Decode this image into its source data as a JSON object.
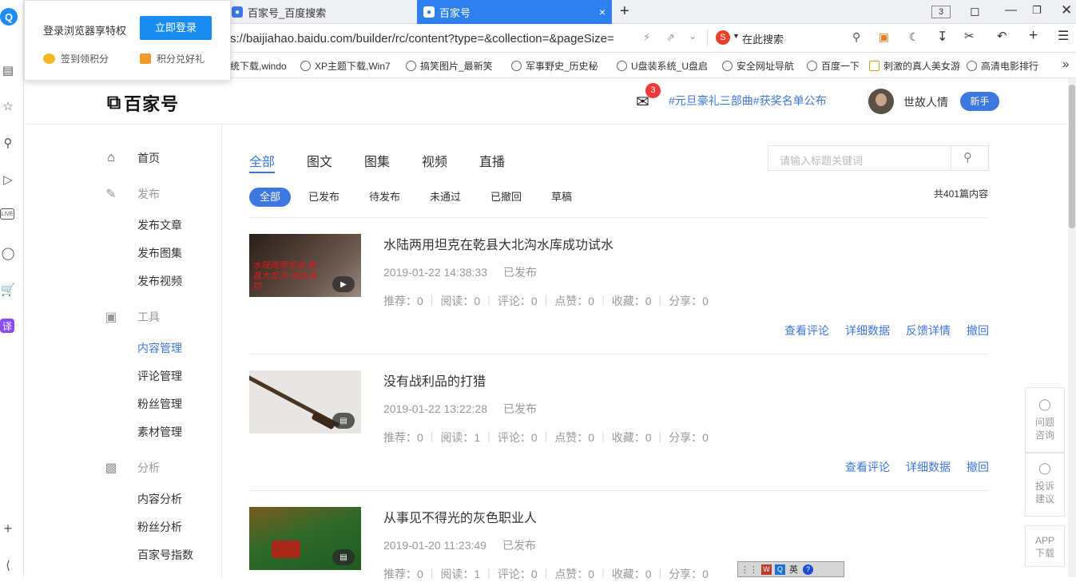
{
  "browser": {
    "tabs": [
      {
        "label": "百家号_百度搜索"
      },
      {
        "label": "百家号",
        "close": "×"
      }
    ],
    "new_tab": "+",
    "tab_count": "3",
    "url": "s://baijiahao.baidu.com/builder/rc/content?type=&collection=&pageSize=",
    "search_placeholder": "在此搜索",
    "bookmarks": [
      "统下载,windo",
      "XP主题下载,Win7",
      "搞笑图片_最新笑",
      "军事野史_历史秘",
      "U盘装系统_U盘启",
      "安全网址导航",
      "百度一下",
      "刺激的真人美女游",
      "高清电影排行"
    ],
    "more": "»"
  },
  "popup": {
    "title": "登录浏览器享特权",
    "login_button": "立即登录",
    "link1": "签到领积分",
    "link2": "积分兑好礼"
  },
  "header": {
    "logo_text": "百家号",
    "mail_badge": "3",
    "promo": "#元旦豪礼三部曲#获奖名单公布",
    "username": "世故人情",
    "level_badge": "新手"
  },
  "sidebar": {
    "home": "首页",
    "publish": "发布",
    "publish_items": [
      "发布文章",
      "发布图集",
      "发布视频"
    ],
    "tools": "工具",
    "tool_items": [
      "内容管理",
      "评论管理",
      "粉丝管理",
      "素材管理"
    ],
    "analysis": "分析",
    "analysis_items": [
      "内容分析",
      "粉丝分析",
      "百家号指数"
    ]
  },
  "content": {
    "type_tabs": [
      "全部",
      "图文",
      "图集",
      "视频",
      "直播"
    ],
    "search_placeholder": "请输入标题关键词",
    "status_chips": [
      "全部",
      "已发布",
      "待发布",
      "未通过",
      "已撤回",
      "草稿"
    ],
    "total": "共401篇内容",
    "stat_labels": [
      "推荐",
      "阅读",
      "评论",
      "点赞",
      "收藏",
      "分享"
    ],
    "items": [
      {
        "title": "水陆两用坦克在乾县大北沟水库成功试水",
        "date": "2019-01-22 14:38:33",
        "status": "已发布",
        "stats": [
          "推荐：0",
          "阅读：0",
          "评论：0",
          "点赞：0",
          "收藏：0",
          "分享：0"
        ],
        "actions": [
          "查看评论",
          "详细数据",
          "反馈详情",
          "撤回"
        ],
        "thumb_text": "水陆两用坦克 乾县大北沟 试水成功"
      },
      {
        "title": "没有战利品的打猎",
        "date": "2019-01-22 13:22:28",
        "status": "已发布",
        "stats": [
          "推荐：0",
          "阅读：1",
          "评论：0",
          "点赞：0",
          "收藏：0",
          "分享：0"
        ],
        "actions": [
          "查看评论",
          "详细数据",
          "撤回"
        ]
      },
      {
        "title": "从事见不得光的灰色职业人",
        "date": "2019-01-20 11:23:49",
        "status": "已发布",
        "stats": [
          "推荐：0",
          "阅读：1",
          "评论：0",
          "点赞：0",
          "收藏：0",
          "分享：0"
        ],
        "actions": []
      }
    ]
  },
  "float": {
    "consult": "问题咨询",
    "complain": "投诉建议",
    "app": "APP下载"
  },
  "ime": {
    "lang": "英"
  },
  "colors": {
    "accent": "#3c78e0",
    "tab_active": "#2e7ff0",
    "badge_red": "#f03a3a"
  }
}
